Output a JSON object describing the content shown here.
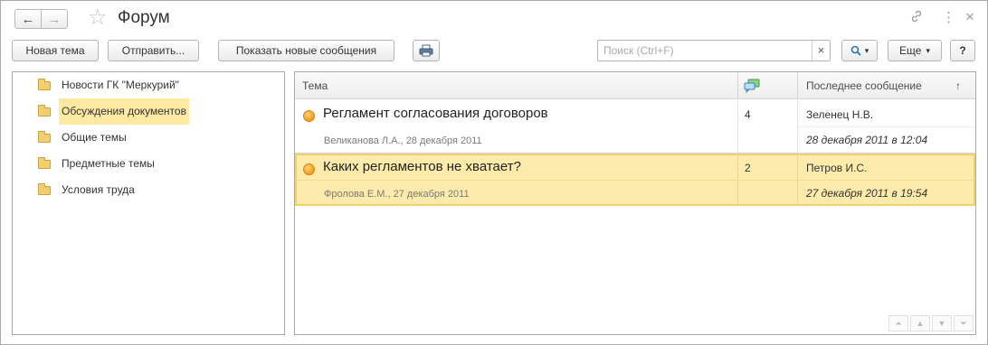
{
  "window": {
    "title": "Форум",
    "nav": {
      "back_icon": "←",
      "forward_icon": "→"
    },
    "favorite_icon": "☆",
    "link_icon": "🔗",
    "more_icon": "⋮",
    "close_icon": "×"
  },
  "toolbar": {
    "new_topic_label": "Новая тема",
    "send_label": "Отправить...",
    "show_new_label": "Показать новые сообщения",
    "print_icon": "🖶",
    "search_placeholder": "Поиск (Ctrl+F)",
    "search_value": "",
    "search_clear_icon": "×",
    "search_button_icon": "🔍",
    "search_dropdown_icon": "▾",
    "more_label": "Еще",
    "more_dropdown_icon": "▾",
    "help_label": "?"
  },
  "tree": {
    "items": [
      {
        "label": "Новости ГК \"Меркурий\"",
        "selected": false
      },
      {
        "label": "Обсуждения документов",
        "selected": true
      },
      {
        "label": "Общие темы",
        "selected": false
      },
      {
        "label": "Предметные темы",
        "selected": false
      },
      {
        "label": "Условия труда",
        "selected": false
      }
    ]
  },
  "table": {
    "columns": {
      "topic": "Тема",
      "messages_icon": "💬",
      "last_message": "Последнее сообщение",
      "sort_icon": "↑"
    },
    "rows": [
      {
        "topic": "Регламент согласования договоров",
        "author_line": "Великанова Л.А., 28 декабря 2011",
        "count": "4",
        "last_user": "Зеленец Н.В.",
        "last_date": "28 декабря 2011 в 12:04",
        "selected": false
      },
      {
        "topic": "Каких регламентов не хватает?",
        "author_line": "Фролова Е.М., 27 декабря 2011",
        "count": "2",
        "last_user": "Петров И.С.",
        "last_date": "27 декабря 2011 в 19:54",
        "selected": true
      }
    ],
    "pager": {
      "first": "⏶",
      "prev": "▲",
      "next": "▼",
      "last": "⏷"
    }
  },
  "colors": {
    "selection": "#fcebaa",
    "selection_border": "#f2d06a",
    "tree_selection": "#fde9a2",
    "bullet": "#f29c1c",
    "folder": "#f2cf6c"
  }
}
